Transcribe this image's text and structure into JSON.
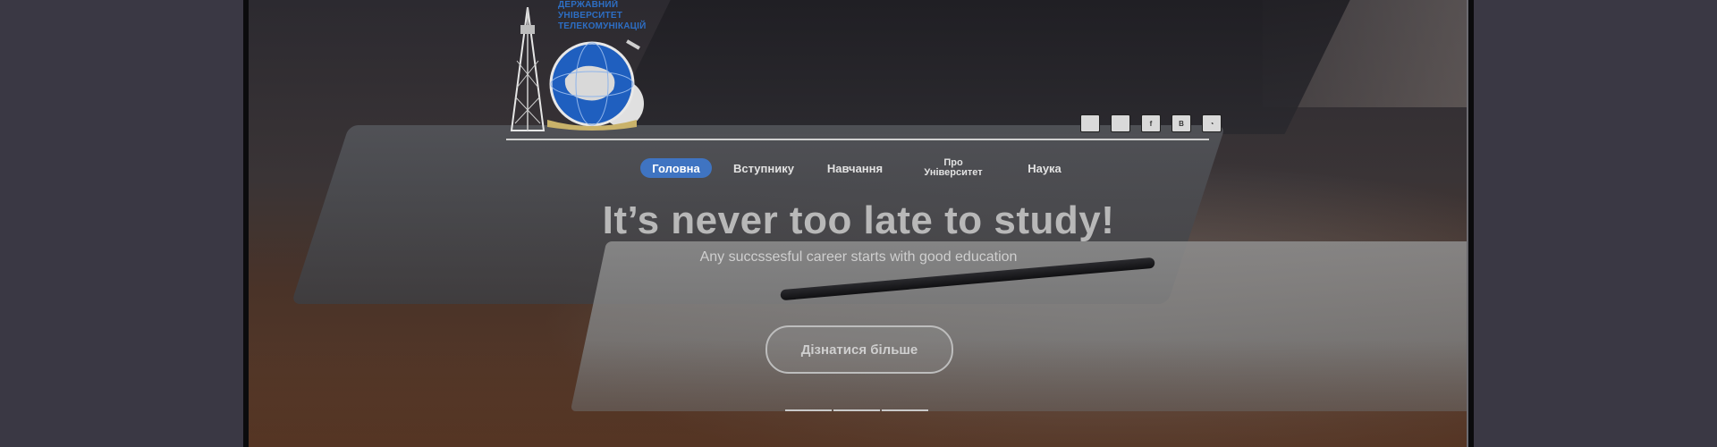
{
  "logo": {
    "text_lines": [
      "Державний",
      "університет",
      "телекомунікацій"
    ],
    "brand_color": "#2d6ec4"
  },
  "socials": [
    {
      "icon": "monitor-icon",
      "glyph": ""
    },
    {
      "icon": "square-icon",
      "glyph": ""
    },
    {
      "icon": "facebook-icon",
      "glyph": "f"
    },
    {
      "icon": "vk-icon",
      "glyph": "B"
    },
    {
      "icon": "rss-icon",
      "glyph": "◔"
    }
  ],
  "nav": {
    "items": [
      {
        "label": "Головна",
        "active": true
      },
      {
        "label": "Вступнику",
        "active": false
      },
      {
        "label": "Навчання",
        "active": false
      },
      {
        "label_line1": "Про",
        "label_line2": "Університет",
        "active": false
      },
      {
        "label": "Наука",
        "active": false
      }
    ],
    "active_color": "#3f74c2"
  },
  "hero": {
    "headline": "It’s never too late to study!",
    "subline": "Any succssesful career starts with good education",
    "cta_label": "Дізнатися більше",
    "slides_count": 3
  }
}
